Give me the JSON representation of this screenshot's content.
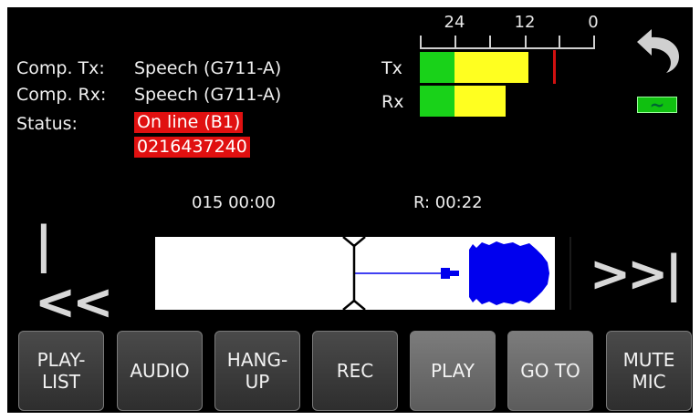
{
  "info": {
    "comp_tx_label": "Comp. Tx:",
    "comp_tx_value": "Speech (G711-A)",
    "comp_rx_label": "Comp. Rx:",
    "comp_rx_value": "Speech (G711-A)",
    "status_label": "Status:",
    "status_line1": "On line (B1)",
    "status_line2": "0216437240"
  },
  "meter": {
    "scale": [
      "24",
      "12",
      "0"
    ],
    "tx_label": "Tx",
    "rx_label": "Rx",
    "tx_level": 0.62,
    "rx_level": 0.49
  },
  "indicators": {
    "back_icon": "undo-arrow-icon",
    "line_icon": "tilde-line-icon",
    "line_symbol": "~",
    "line_color": "#10c010"
  },
  "playback": {
    "position": "015 00:00",
    "remaining": "R: 00:22"
  },
  "nav": {
    "prev_label": "|<<",
    "next_label": ">>|"
  },
  "buttons": {
    "playlist": "PLAY-\nLIST",
    "audio": "AUDIO",
    "hangup": "HANG-\nUP",
    "rec": "REC",
    "play": "PLAY",
    "goto": "GO TO",
    "mute": "MUTE\nMIC"
  },
  "colors": {
    "status_bg": "#e01010",
    "meter_green": "#19d219",
    "meter_yellow": "#ffff20",
    "peak_marker": "#d01010",
    "waveform": "#0000ee"
  }
}
